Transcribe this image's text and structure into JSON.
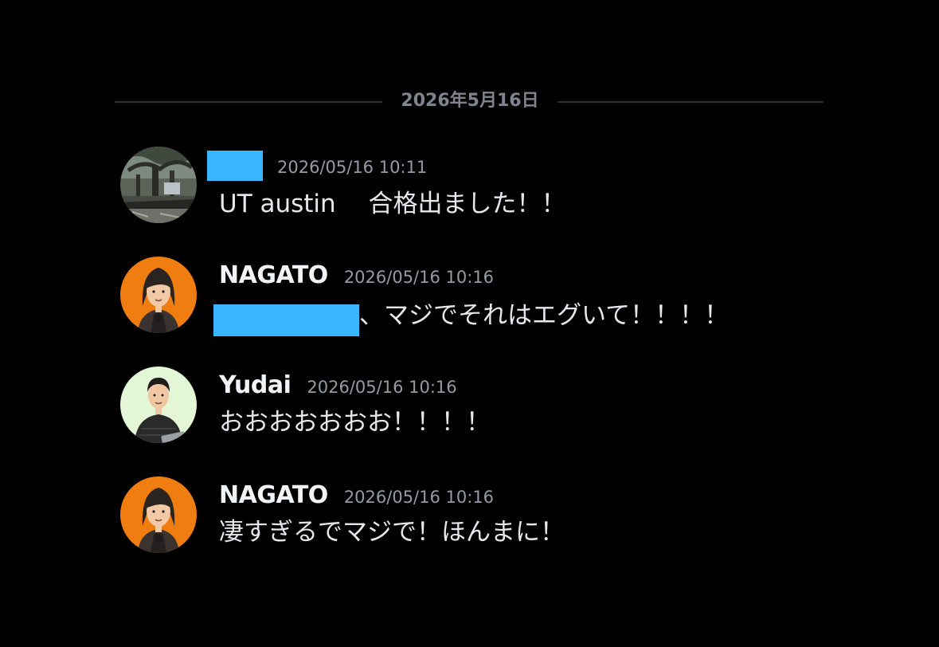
{
  "date_divider": "2026年5月16日",
  "messages": [
    {
      "author": "",
      "author_redacted": true,
      "timestamp": "2026/05/16 10:11",
      "content": "UT austin　 合格出ました！！",
      "avatar": "photo-avatar"
    },
    {
      "author": "NAGATO",
      "timestamp": "2026/05/16 10:16",
      "content_prefix_redacted": true,
      "content": "、マジでそれはエグいて！！！！",
      "avatar": "illustrated-avatar-orange"
    },
    {
      "author": "Yudai",
      "timestamp": "2026/05/16 10:16",
      "content": "おおおおおおお！！！！",
      "avatar": "illustrated-avatar-green"
    },
    {
      "author": "NAGATO",
      "timestamp": "2026/05/16 10:16",
      "content": "凄すぎるでマジで！ほんまに！",
      "avatar": "illustrated-avatar-orange"
    }
  ],
  "colors": {
    "background": "#000000",
    "redaction": "#38b6ff",
    "orange_avatar_bg": "#f07d0f",
    "green_avatar_bg": "#e3f7d6"
  }
}
